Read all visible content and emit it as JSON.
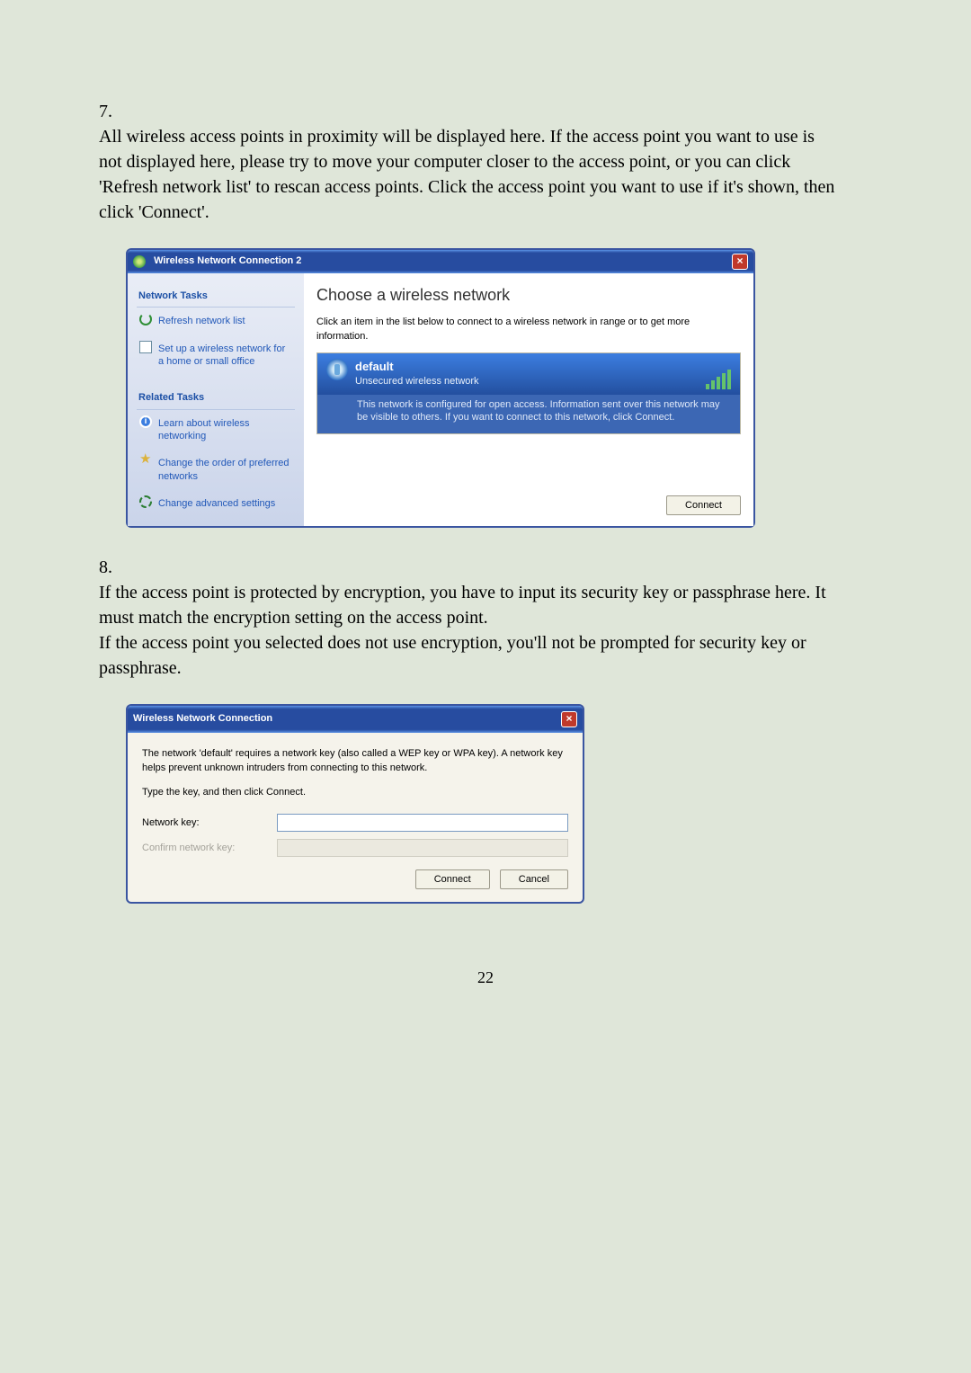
{
  "step7": {
    "num": "7.",
    "text": "All wireless access points in proximity will be displayed here. If the access point you want to use is not displayed here, please try to move your computer closer to the access point, or you can click 'Refresh network list' to rescan access points. Click the access point you want to use if it's shown, then click 'Connect'."
  },
  "dlg1": {
    "title": "Wireless Network Connection 2",
    "sidebar": {
      "h1": "Network Tasks",
      "refresh": "Refresh network list",
      "setup": "Set up a wireless network for a home or small office",
      "h2": "Related Tasks",
      "learn": "Learn about wireless networking",
      "order": "Change the order of preferred networks",
      "adv": "Change advanced settings"
    },
    "main": {
      "h": "Choose a wireless network",
      "sub": "Click an item in the list below to connect to a wireless network in range or to get more information.",
      "ap_name": "default",
      "ap_sec": "Unsecured wireless network",
      "ap_note": "This network is configured for open access. Information sent over this network may be visible to others. If you want to connect to this network, click Connect.",
      "connect": "Connect"
    }
  },
  "step8": {
    "num": "8.",
    "text_a": "If the access point is protected by encryption, you have to input its security key or passphrase here. It must match the encryption setting on the access point.",
    "text_b": "If the access point you selected does not use encryption, you'll not be prompted for security key or passphrase."
  },
  "dlg2": {
    "title": "Wireless Network Connection",
    "desc": "The network 'default' requires a network key (also called a WEP key or WPA key). A network key helps prevent unknown intruders from connecting to this network.",
    "type_prompt": "Type the key, and then click Connect.",
    "key_l": "Network key:",
    "confirm_l": "Confirm network key:",
    "connect": "Connect",
    "cancel": "Cancel"
  },
  "page_number": "22"
}
